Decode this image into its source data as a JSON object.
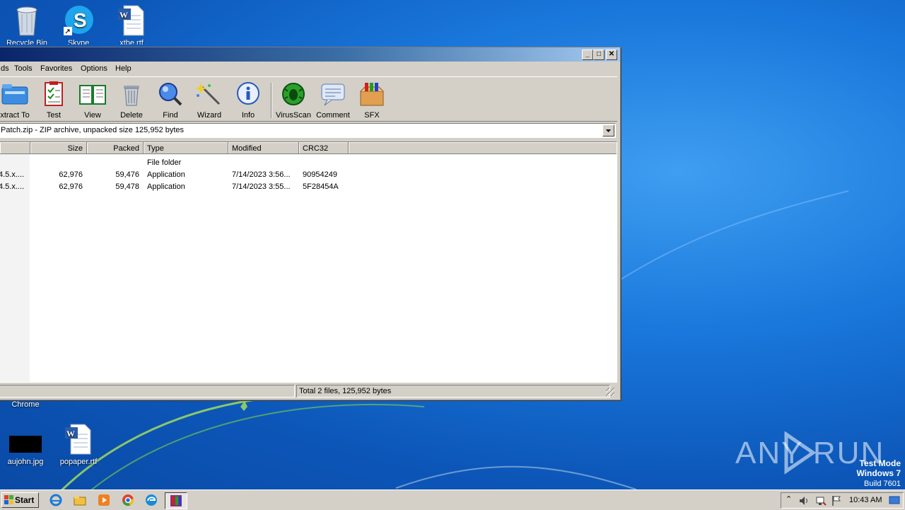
{
  "desktop": {
    "icons": [
      {
        "label": "Recycle Bin"
      },
      {
        "label": "Skype"
      },
      {
        "label": "xtbe.rtf"
      },
      {
        "label": "Chrome"
      },
      {
        "label": "aujohn.jpg"
      },
      {
        "label": "popaper.rtf"
      }
    ]
  },
  "window": {
    "title_buttons": {
      "minimize": "_",
      "maximize": "□",
      "close": "✕"
    },
    "menu": [
      "ds",
      "Tools",
      "Favorites",
      "Options",
      "Help"
    ],
    "toolbar": [
      {
        "label": "xtract To",
        "icon": "extract-folder-icon"
      },
      {
        "label": "Test",
        "icon": "checklist-icon"
      },
      {
        "label": "View",
        "icon": "book-icon"
      },
      {
        "label": "Delete",
        "icon": "trash-icon"
      },
      {
        "label": "Find",
        "icon": "magnifier-icon"
      },
      {
        "label": "Wizard",
        "icon": "magic-wand-icon"
      },
      {
        "label": "Info",
        "icon": "info-icon"
      },
      {
        "label": "VirusScan",
        "icon": "bug-icon"
      },
      {
        "label": "Comment",
        "icon": "comment-icon"
      },
      {
        "label": "SFX",
        "icon": "sfx-box-icon"
      }
    ],
    "address": "Patch.zip - ZIP archive, unpacked size 125,952 bytes",
    "columns": [
      "Size",
      "Packed",
      "Type",
      "Modified",
      "CRC32"
    ],
    "rows": [
      {
        "name": "",
        "size": "",
        "packed": "",
        "type": "File folder",
        "modified": "",
        "crc": ""
      },
      {
        "name": "4.5.x....",
        "size": "62,976",
        "packed": "59,476",
        "type": "Application",
        "modified": "7/14/2023 3:56...",
        "crc": "90954249"
      },
      {
        "name": "4.5.x....",
        "size": "62,976",
        "packed": "59,478",
        "type": "Application",
        "modified": "7/14/2023 3:55...",
        "crc": "5F28454A"
      }
    ],
    "status": "Total 2 files, 125,952 bytes"
  },
  "taskbar": {
    "start": "Start",
    "clock": "10:43 AM"
  },
  "watermark": {
    "brand": "ANY RUN",
    "line1": "Test Mode",
    "line2": "Windows 7",
    "line3": "Build 7601"
  }
}
